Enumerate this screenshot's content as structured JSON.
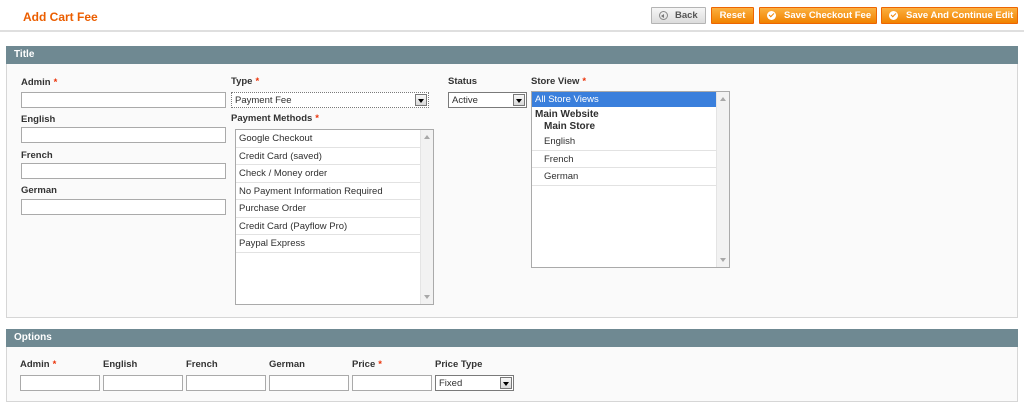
{
  "header": {
    "title": "Add Cart Fee",
    "back_label": "Back",
    "reset_label": "Reset",
    "save_fee_label": "Save Checkout Fee",
    "save_continue_label": "Save And Continue Edit"
  },
  "title_section": {
    "heading": "Title",
    "fields": {
      "admin_label": "Admin",
      "english_label": "English",
      "french_label": "French",
      "german_label": "German",
      "admin_value": "",
      "english_value": "",
      "french_value": "",
      "german_value": ""
    },
    "type": {
      "label": "Type",
      "selected": "Payment Fee"
    },
    "payment_methods": {
      "label": "Payment Methods",
      "options": [
        "Google Checkout",
        "Credit Card (saved)",
        "Check / Money order",
        "No Payment Information Required",
        "Purchase Order",
        "Credit Card (Payflow Pro)",
        "Paypal Express"
      ]
    },
    "status": {
      "label": "Status",
      "selected": "Active"
    },
    "store_view": {
      "label": "Store View",
      "selected": "All Store Views",
      "website": "Main Website",
      "store": "Main Store",
      "views": [
        "English",
        "French",
        "German"
      ]
    }
  },
  "options_section": {
    "heading": "Options",
    "admin_label": "Admin",
    "english_label": "English",
    "french_label": "French",
    "german_label": "German",
    "price_label": "Price",
    "price_type_label": "Price Type",
    "price_type_selected": "Fixed"
  },
  "required_mark": "*",
  "colors": {
    "accent": "#eb5e00",
    "section_header": "#6f8992",
    "button_orange": "#f18200",
    "selection": "#3a7fdc"
  }
}
